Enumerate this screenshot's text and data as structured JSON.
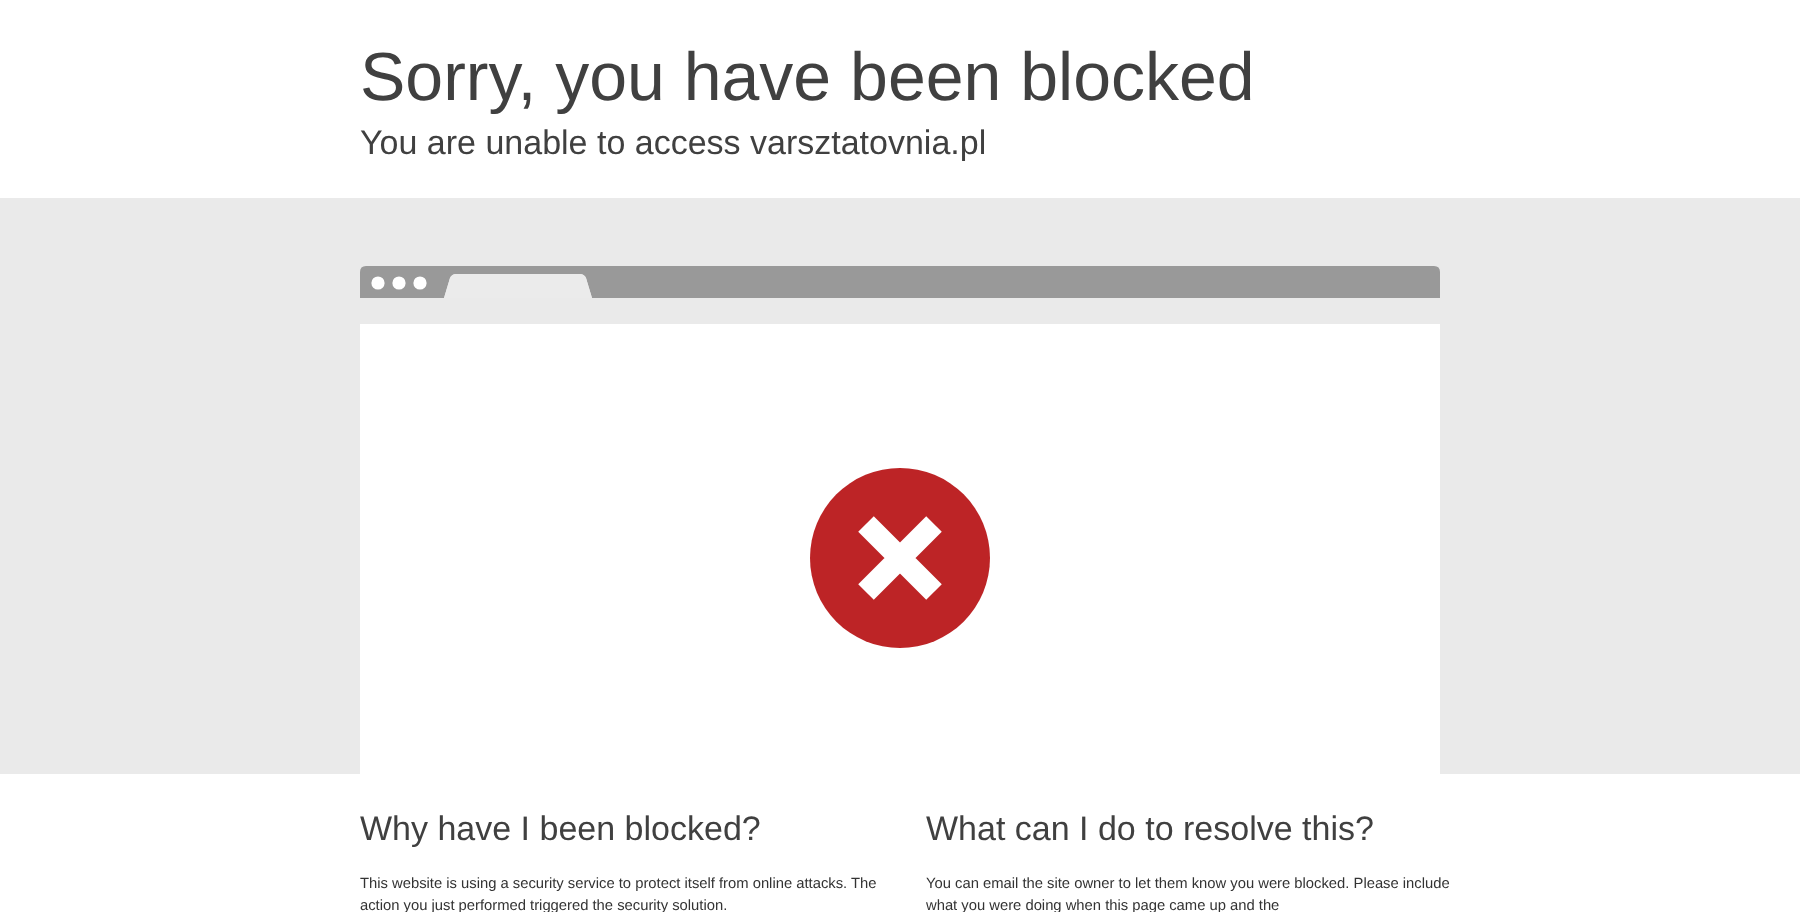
{
  "header": {
    "title": "Sorry, you have been blocked",
    "subtitle": "You are unable to access varsztatovnia.pl"
  },
  "sections": [
    {
      "heading": "Why have I been blocked?",
      "text": "This website is using a security service to protect itself from online attacks. The action you just performed triggered the security solution."
    },
    {
      "heading": "What can I do to resolve this?",
      "text": "You can email the site owner to let them know you were blocked. Please include what you were doing when this page came up and the"
    }
  ]
}
